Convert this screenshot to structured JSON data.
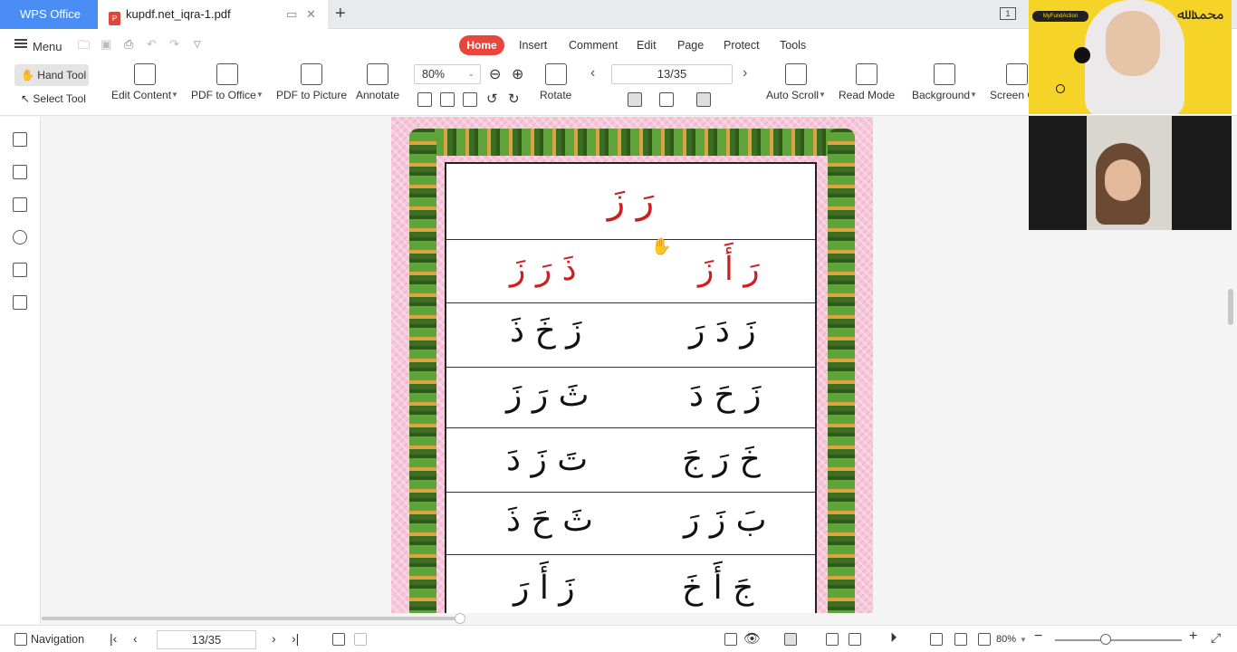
{
  "titlebar": {
    "app_tab": "WPS Office",
    "doc_tab": "kupdf.net_iqra-1.pdf",
    "new_tab": "+",
    "window_count": "1"
  },
  "menu": {
    "menu_label": "Menu",
    "tabs": [
      "Home",
      "Insert",
      "Comment",
      "Edit",
      "Page",
      "Protect",
      "Tools"
    ]
  },
  "ribbon": {
    "hand_tool": "Hand Tool",
    "select_tool": "Select Tool",
    "edit_content": "Edit Content",
    "pdf_to_office": "PDF to Office",
    "pdf_to_picture": "PDF to Picture",
    "annotate": "Annotate",
    "zoom": "80%",
    "rotate": "Rotate",
    "page_indicator": "13/35",
    "auto_scroll": "Auto Scroll",
    "read_mode": "Read Mode",
    "background": "Background",
    "screen_grab": "Screen G"
  },
  "document": {
    "rows": [
      {
        "single": "رَ زَ",
        "red": true
      },
      {
        "right": "رَ أَ زَ",
        "left": "ذَ رَ زَ",
        "red": true
      },
      {
        "right": "زَ دَ رَ",
        "left": "زَ خَ ذَ",
        "red": false
      },
      {
        "right": "زَ حَ دَ",
        "left": "ثَ رَ زَ",
        "red": false
      },
      {
        "right": "خَ رَ جَ",
        "left": "تَ زَ دَ",
        "red": false
      },
      {
        "right": "بَ زَ رَ",
        "left": "ثَ حَ ذَ",
        "red": false
      },
      {
        "right": "جَ أَ خَ",
        "left": "زَ أَ رَ",
        "red": false
      }
    ]
  },
  "statusbar": {
    "navigation": "Navigation",
    "page_indicator": "13/35",
    "zoom": "80%"
  },
  "video": {
    "badge": "MyFundAction"
  },
  "colors": {
    "accent": "#e8453c",
    "wps_blue": "#4a8ef5",
    "arabic_red": "#cc1f24"
  }
}
